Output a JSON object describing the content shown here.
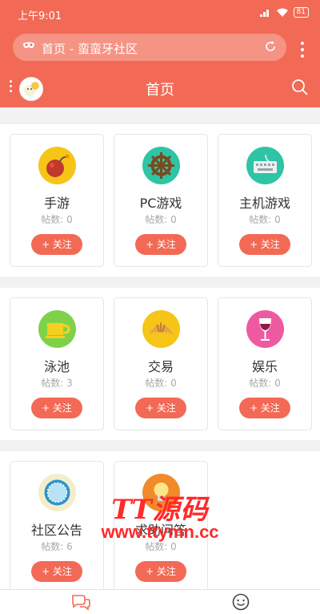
{
  "status": {
    "time": "上午9:01",
    "battery": "81"
  },
  "browser": {
    "url_text": "首页 - 蛮蛮牙社区"
  },
  "header": {
    "title": "首页"
  },
  "sections": [
    {
      "cards": [
        {
          "name": "手游",
          "posts": "帖数: 0",
          "follow": "+ 关注",
          "icon": "bomb-icon",
          "color": "#f5c518"
        },
        {
          "name": "PC游戏",
          "posts": "帖数: 0",
          "follow": "+ 关注",
          "icon": "ship-wheel-icon",
          "color": "#2ec4a6"
        },
        {
          "name": "主机游戏",
          "posts": "帖数: 0",
          "follow": "+ 关注",
          "icon": "keyboard-icon",
          "color": "#2ec4a6"
        }
      ]
    },
    {
      "cards": [
        {
          "name": "泳池",
          "posts": "帖数: 3",
          "follow": "+ 关注",
          "icon": "cup-icon",
          "color": "#7ed24a"
        },
        {
          "name": "交易",
          "posts": "帖数: 0",
          "follow": "+ 关注",
          "icon": "croissant-icon",
          "color": "#f5c518"
        },
        {
          "name": "娱乐",
          "posts": "帖数: 0",
          "follow": "+ 关注",
          "icon": "wine-glass-icon",
          "color": "#ee5aa1"
        }
      ]
    },
    {
      "cards": [
        {
          "name": "社区公告",
          "posts": "帖数: 6",
          "follow": "+ 关注",
          "icon": "plate-icon",
          "color": "#f4edcc"
        },
        {
          "name": "求助问答",
          "posts": "帖数: 0",
          "follow": "+ 关注",
          "icon": "bulb-icon",
          "color": "#f08a2a"
        }
      ]
    }
  ],
  "watermark": {
    "line1": "TT源码",
    "line2": "www.ttymn.cc"
  }
}
